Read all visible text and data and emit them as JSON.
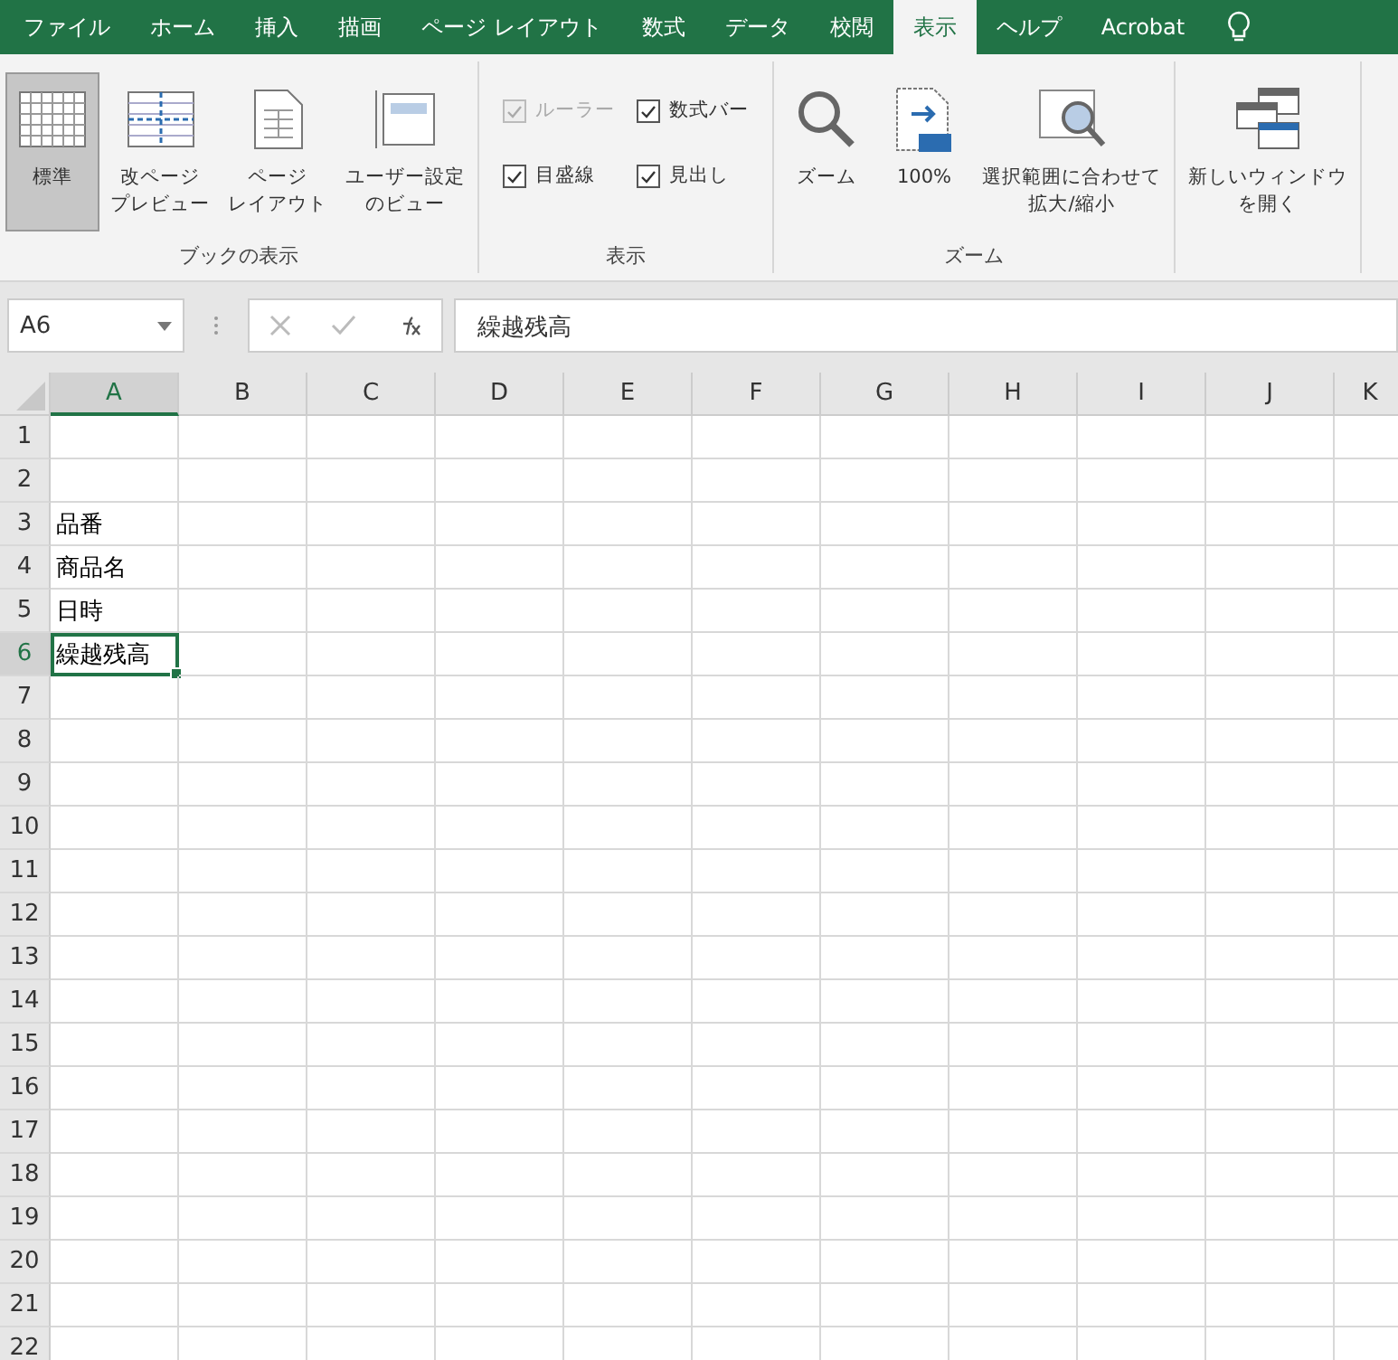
{
  "tabs": [
    {
      "label": "ファイル",
      "selected": false
    },
    {
      "label": "ホーム",
      "selected": false
    },
    {
      "label": "挿入",
      "selected": false
    },
    {
      "label": "描画",
      "selected": false
    },
    {
      "label": "ページ レイアウト",
      "selected": false
    },
    {
      "label": "数式",
      "selected": false
    },
    {
      "label": "データ",
      "selected": false
    },
    {
      "label": "校閲",
      "selected": false
    },
    {
      "label": "表示",
      "selected": true
    },
    {
      "label": "ヘルプ",
      "selected": false
    },
    {
      "label": "Acrobat",
      "selected": false
    }
  ],
  "ribbon": {
    "groups": [
      {
        "label": "ブックの表示",
        "items": [
          {
            "kind": "large",
            "lines": [
              "標準"
            ],
            "selected": true
          },
          {
            "kind": "large",
            "lines": [
              "改ページ",
              "プレビュー"
            ],
            "selected": false
          },
          {
            "kind": "large",
            "lines": [
              "ページ",
              "レイアウト"
            ],
            "selected": false
          },
          {
            "kind": "large",
            "lines": [
              "ユーザー設定",
              "のビュー"
            ],
            "selected": false
          }
        ]
      },
      {
        "label": "表示",
        "items": [
          {
            "kind": "checkbox",
            "label": "ルーラー",
            "checked": true,
            "disabled": true
          },
          {
            "kind": "checkbox",
            "label": "数式バー",
            "checked": true,
            "disabled": false
          },
          {
            "kind": "checkbox",
            "label": "目盛線",
            "checked": true,
            "disabled": false
          },
          {
            "kind": "checkbox",
            "label": "見出し",
            "checked": true,
            "disabled": false
          }
        ]
      },
      {
        "label": "ズーム",
        "items": [
          {
            "kind": "large",
            "lines": [
              "ズーム"
            ],
            "selected": false
          },
          {
            "kind": "large",
            "lines": [
              "100%"
            ],
            "selected": false
          },
          {
            "kind": "large",
            "lines": [
              "選択範囲に合わせて",
              "拡大/縮小"
            ],
            "selected": false
          }
        ]
      },
      {
        "items": [
          {
            "kind": "large",
            "lines": [
              "新しいウィンドウ",
              "を開く"
            ],
            "selected": false
          }
        ]
      }
    ]
  },
  "formula_bar": {
    "name_box": "A6",
    "content": "繰越残高"
  },
  "sheet": {
    "columns": [
      {
        "label": "A",
        "selected": true
      },
      {
        "label": "B",
        "selected": false
      },
      {
        "label": "C",
        "selected": false
      },
      {
        "label": "D",
        "selected": false
      },
      {
        "label": "E",
        "selected": false
      },
      {
        "label": "F",
        "selected": false
      },
      {
        "label": "G",
        "selected": false
      },
      {
        "label": "H",
        "selected": false
      },
      {
        "label": "I",
        "selected": false
      },
      {
        "label": "J",
        "selected": false
      },
      {
        "label": "K",
        "selected": false
      }
    ],
    "rows": [
      {
        "label": "1",
        "selected": false
      },
      {
        "label": "2",
        "selected": false
      },
      {
        "label": "3",
        "selected": false,
        "cell_a": "品番"
      },
      {
        "label": "4",
        "selected": false,
        "cell_a": "商品名"
      },
      {
        "label": "5",
        "selected": false,
        "cell_a": "日時"
      },
      {
        "label": "6",
        "selected": true,
        "cell_a": "繰越残高"
      },
      {
        "label": "7",
        "selected": false
      },
      {
        "label": "8",
        "selected": false
      },
      {
        "label": "9",
        "selected": false
      },
      {
        "label": "10",
        "selected": false
      },
      {
        "label": "11",
        "selected": false
      },
      {
        "label": "12",
        "selected": false
      },
      {
        "label": "13",
        "selected": false
      },
      {
        "label": "14",
        "selected": false
      },
      {
        "label": "15",
        "selected": false
      },
      {
        "label": "16",
        "selected": false
      },
      {
        "label": "17",
        "selected": false
      },
      {
        "label": "18",
        "selected": false
      },
      {
        "label": "19",
        "selected": false
      },
      {
        "label": "20",
        "selected": false
      },
      {
        "label": "21",
        "selected": false
      },
      {
        "label": "22",
        "selected": false
      }
    ]
  }
}
